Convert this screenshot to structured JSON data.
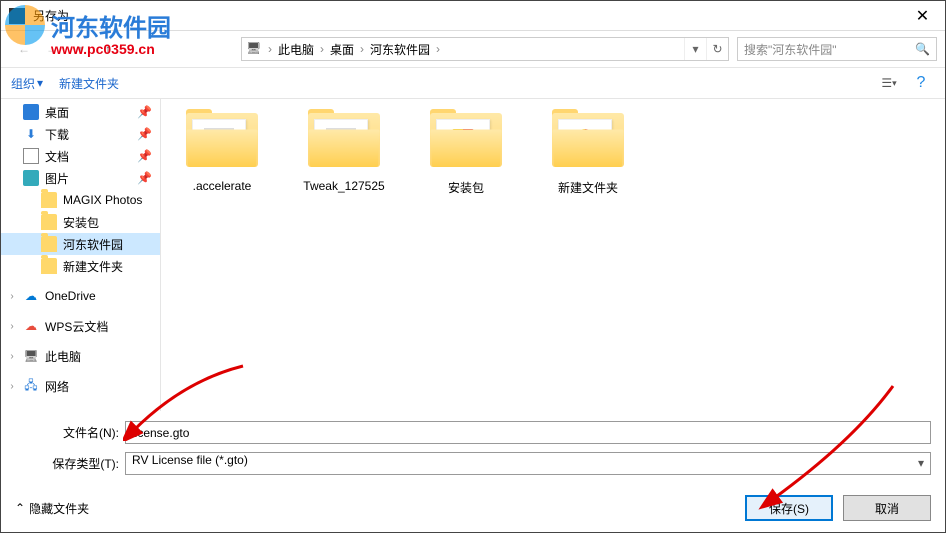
{
  "window": {
    "title": "另存为"
  },
  "watermark": {
    "text": "河东软件园",
    "url": "www.pc0359.cn"
  },
  "nav": {
    "crumbs": [
      "此电脑",
      "桌面",
      "河东软件园"
    ],
    "search_placeholder": "搜索\"河东软件园\""
  },
  "toolbar": {
    "organize": "组织",
    "new_folder": "新建文件夹"
  },
  "tree": {
    "items": [
      {
        "label": "桌面",
        "icon": "desktop",
        "pinned": true
      },
      {
        "label": "下载",
        "icon": "download",
        "pinned": true
      },
      {
        "label": "文档",
        "icon": "docs",
        "pinned": true
      },
      {
        "label": "图片",
        "icon": "pics",
        "pinned": true
      },
      {
        "label": "MAGIX Photos",
        "icon": "folder",
        "indent": true
      },
      {
        "label": "安装包",
        "icon": "folder",
        "indent": true
      },
      {
        "label": "河东软件园",
        "icon": "folder",
        "indent": true,
        "selected": true
      },
      {
        "label": "新建文件夹",
        "icon": "folder",
        "indent": true
      },
      {
        "label": "OneDrive",
        "icon": "onedrive",
        "expander": ">"
      },
      {
        "label": "WPS云文档",
        "icon": "wps",
        "expander": ">"
      },
      {
        "label": "此电脑",
        "icon": "pc",
        "expander": ">"
      },
      {
        "label": "网络",
        "icon": "network",
        "expander": ">"
      }
    ]
  },
  "files": [
    {
      "label": ".accelerate",
      "inner": "stripes"
    },
    {
      "label": "Tweak_127525",
      "inner": "stripes"
    },
    {
      "label": "安装包",
      "inner": "colorbox"
    },
    {
      "label": "新建文件夹",
      "inner": "colorcircle"
    }
  ],
  "fields": {
    "filename_label": "文件名(N):",
    "filename_value": "license.gto",
    "type_label": "保存类型(T):",
    "type_value": "RV License file (*.gto)"
  },
  "footer": {
    "hide_folders": "隐藏文件夹",
    "save": "保存(S)",
    "cancel": "取消"
  }
}
